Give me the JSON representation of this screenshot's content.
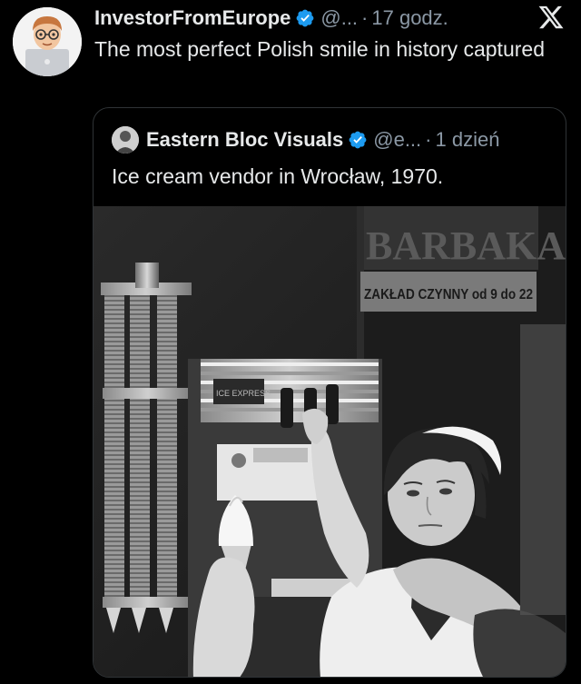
{
  "tweet": {
    "author_name": "InvestorFromEurope",
    "handle": "@...",
    "separator": "·",
    "time": "17 godz.",
    "text": "The most perfect Polish smile in history captured"
  },
  "quoted_tweet": {
    "author_name": "Eastern Bloc Visuals",
    "handle": "@e...",
    "separator": "·",
    "time": "1 dzień",
    "text": "Ice cream vendor in Wrocław, 1970."
  },
  "photo": {
    "sign_top": "BARBAKAN",
    "sign_bottom": "ZAKŁAD CZYNNY od 9 do 22",
    "machine_label": "ICE EXPRESS"
  },
  "colors": {
    "background": "#000000",
    "text_primary": "#e7e9ea",
    "text_muted": "#8b98a5",
    "verified_blue": "#1d9bf0",
    "border": "#2f3336"
  },
  "icons": {
    "verified": "verified-badge-icon",
    "close_brand": "x-logo-icon"
  }
}
